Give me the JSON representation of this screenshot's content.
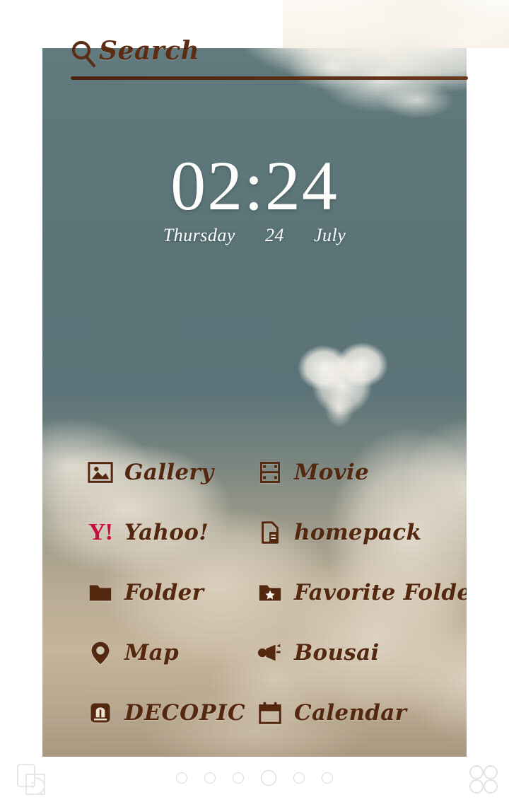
{
  "wallpaper": {
    "description": "heart-shaped cloud in teal sky with cumulus clouds",
    "sky_color": "#5a7478",
    "cloud_color": "#faf5ec",
    "warm_haze_color": "#c6b08e"
  },
  "theme": {
    "accent_brown": "#54270f",
    "search_brown": "#5a2d14",
    "clock_white": "#fdfdfb",
    "yahoo_red": "#c8103c",
    "dot_gray": "#d9dade"
  },
  "search": {
    "icon": "search-icon",
    "label": "Search",
    "placeholder": "Search"
  },
  "clock": {
    "time": "02:24",
    "weekday": "Thursday",
    "day": "24",
    "month": "July"
  },
  "apps": [
    {
      "label": "Gallery",
      "icon": "image-icon",
      "caps": false
    },
    {
      "label": "Movie",
      "icon": "film-strip-icon",
      "caps": false
    },
    {
      "label": "Yahoo!",
      "icon": "yahoo-logo-icon",
      "caps": false,
      "logo_text": "Y!"
    },
    {
      "label": "homepack",
      "icon": "homepack-page-icon",
      "caps": false
    },
    {
      "label": "Folder",
      "icon": "folder-icon",
      "caps": false
    },
    {
      "label": "Favorite Folder",
      "icon": "folder-star-icon",
      "caps": false
    },
    {
      "label": "Map",
      "icon": "map-pin-icon",
      "caps": false
    },
    {
      "label": "Bousai",
      "icon": "megaphone-icon",
      "caps": false
    },
    {
      "label": "DECOPIC",
      "icon": "decopic-icon",
      "caps": true
    },
    {
      "label": "Calendar",
      "icon": "calendar-icon",
      "caps": false
    }
  ],
  "bottom_bar": {
    "left_icon": "theme-page-icon",
    "right_icon": "app-drawer-grid-icon",
    "page_count": 6,
    "current_page": 4
  }
}
